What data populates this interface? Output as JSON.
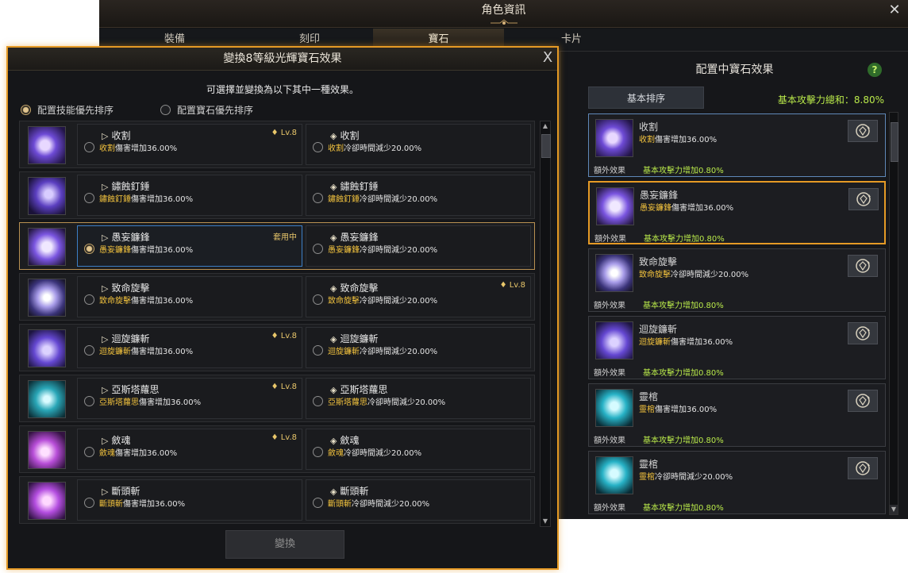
{
  "background_window": {
    "title": "角色資訊",
    "tabs": [
      "裝備",
      "刻印",
      "寶石",
      "卡片"
    ],
    "active_tab": "寶石"
  },
  "right_panel": {
    "title": "配置中寶石效果",
    "help": "?",
    "sort_button": "基本排序",
    "total_label": "基本攻擊力總和：8.80%",
    "cards": [
      {
        "name": "收割",
        "effect_skill": "收割",
        "effect_rest": "傷害增加36.00%",
        "extra_label": "額外效果",
        "extra_value": "基本攻擊力增加0.80%",
        "icon": "harvest-skill-icon"
      },
      {
        "name": "愚妄鐮鋒",
        "effect_skill": "愚妄鐮鋒",
        "effect_rest": "傷害增加36.00%",
        "extra_label": "額外效果",
        "extra_value": "基本攻擊力增加0.80%",
        "icon": "folly-scythe-skill-icon"
      },
      {
        "name": "致命旋擊",
        "effect_skill": "致命旋擊",
        "effect_rest": "冷卻時間減少20.00%",
        "extra_label": "額外效果",
        "extra_value": "基本攻擊力增加0.80%",
        "icon": "fatal-spin-skill-icon"
      },
      {
        "name": "迴旋鐮斬",
        "effect_skill": "迴旋鐮斬",
        "effect_rest": "傷害增加36.00%",
        "extra_label": "額外效果",
        "extra_value": "基本攻擊力增加0.80%",
        "icon": "spin-scythe-skill-icon"
      },
      {
        "name": "靈棺",
        "effect_skill": "靈棺",
        "effect_rest": "傷害增加36.00%",
        "extra_label": "額外效果",
        "extra_value": "基本攻擊力增加0.80%",
        "icon": "spirit-coffin-skill-icon"
      },
      {
        "name": "靈棺",
        "effect_skill": "靈棺",
        "effect_rest": "冷卻時間減少20.00%",
        "extra_label": "額外效果",
        "extra_value": "基本攻擊力增加0.80%",
        "icon": "spirit-coffin-skill-icon"
      }
    ]
  },
  "dialog": {
    "title": "變換8等級光輝寶石效果",
    "close": "X",
    "subtitle": "可選擇並變換為以下其中一種效果。",
    "sort_options": [
      "配置技能優先排序",
      "配置寶石優先排序"
    ],
    "sort_selected": 0,
    "swap_button": "變換",
    "rows": [
      {
        "skill": "收割",
        "icon": "harvest-skill-icon",
        "dmg_tag": "Lv.8",
        "cd_tag": "",
        "current": false
      },
      {
        "skill": "鏽蝕釘錘",
        "icon": "rust-hammer-skill-icon",
        "dmg_tag": "",
        "cd_tag": "",
        "current": false
      },
      {
        "skill": "愚妄鐮鋒",
        "icon": "folly-scythe-skill-icon",
        "dmg_tag": "套用中",
        "cd_tag": "",
        "current": true
      },
      {
        "skill": "致命旋擊",
        "icon": "fatal-spin-skill-icon",
        "dmg_tag": "",
        "cd_tag": "Lv.8",
        "current": false
      },
      {
        "skill": "迴旋鐮斬",
        "icon": "spin-scythe-skill-icon",
        "dmg_tag": "Lv.8",
        "cd_tag": "",
        "current": false
      },
      {
        "skill": "亞斯塔蘿思",
        "icon": "astaroth-skill-icon",
        "dmg_tag": "Lv.8",
        "cd_tag": "",
        "current": false
      },
      {
        "skill": "斂魂",
        "icon": "soul-gather-skill-icon",
        "dmg_tag": "Lv.8",
        "cd_tag": "",
        "current": false
      },
      {
        "skill": "斷頭斬",
        "icon": "decapitate-skill-icon",
        "dmg_tag": "",
        "cd_tag": "",
        "current": false
      }
    ],
    "dmg_effect": "傷害增加36.00%",
    "cd_effect": "冷卻時間減少20.00%"
  },
  "colors": {
    "accent_orange": "#e59a25",
    "highlight_yellow": "#f3c33e",
    "bonus_green": "#b9e94a",
    "selected_blue": "#3d7fc6"
  }
}
